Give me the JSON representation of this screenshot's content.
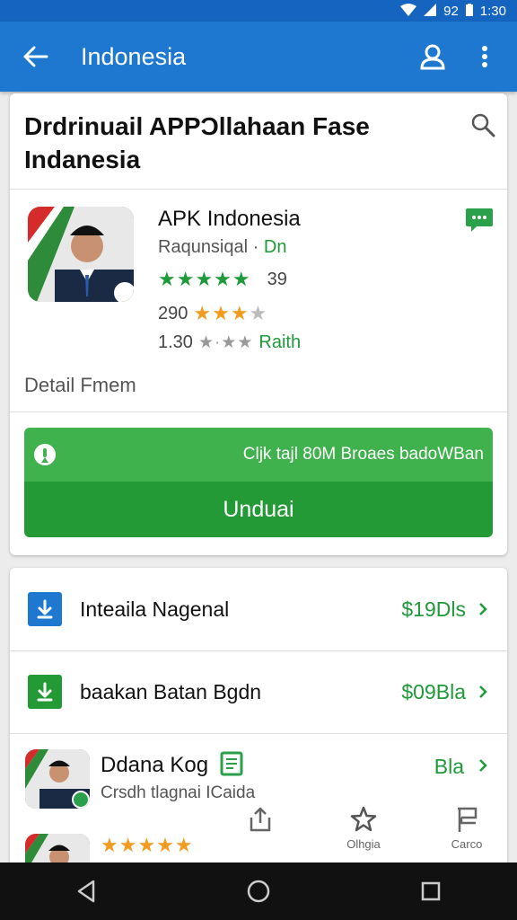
{
  "status_bar": {
    "time": "1:30",
    "battery": "92"
  },
  "app_bar": {
    "title": "Indonesia",
    "back_icon": "back-arrow-icon",
    "account_icon": "account-icon",
    "menu_icon": "overflow-menu-icon"
  },
  "header": {
    "title": "Drdrinuail APPƆllahaan Fase Indanesia",
    "search_icon": "search-icon"
  },
  "app": {
    "name": "APK Indonesia",
    "developer": "Raqunsiqal",
    "developer_sep": "·",
    "developer_tag": "Dn",
    "rating1_stars": "★★★★★",
    "rating1_value": "39",
    "rating2_value": "290",
    "rating2_stars": "★★★",
    "rating2_star_empty": "★",
    "rating3_value": "1.30",
    "rating3_stars": "★·★★",
    "rating3_tag": "Raith",
    "detail_link": "Detail Fmem"
  },
  "info": {
    "text": "Cljk tajl 80M Broaes badoWBan"
  },
  "download": {
    "label": "Unduai"
  },
  "list": [
    {
      "label": "Inteaila Nagenal",
      "price": "$19Dls"
    },
    {
      "label": "baakan Batan Bgdn",
      "price": "$09Bla"
    }
  ],
  "featured": {
    "title": "Ddana Kog",
    "subtitle": "Crsdh tlagnai ICaida",
    "price": "Bla",
    "stars": "★★★★★"
  },
  "bottom_actions": [
    {
      "label": "",
      "icon": "share-icon"
    },
    {
      "label": "Olhgia",
      "icon": "star-outline-icon"
    },
    {
      "label": "Carco",
      "icon": "flag-icon"
    }
  ],
  "colors": {
    "app_bar": "#1e78d0",
    "status_bar": "#1565c0",
    "accent_green": "#239a35",
    "info_green": "#3fb24d",
    "star_green": "#1e9a3a",
    "star_orange": "#f29b1e"
  }
}
